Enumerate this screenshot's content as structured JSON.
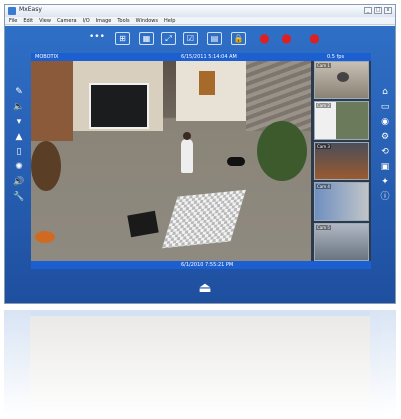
{
  "window": {
    "title": "MxEasy",
    "controls": [
      "_",
      "□",
      "x"
    ]
  },
  "menu": [
    "File",
    "Edit",
    "View",
    "Camera",
    "I/O",
    "Image",
    "Tools",
    "Windows",
    "Help"
  ],
  "toolbar": {
    "dots": "•••",
    "icons": [
      "layout-full-icon",
      "layout-grid-icon",
      "expand-icon",
      "check-icon",
      "export-icon",
      "lock-icon",
      "record-icon",
      "alarm-icon",
      "cloud-icon"
    ]
  },
  "video": {
    "top_left": "MOBOTIX",
    "top_center": "6/15/2011 5:14:04 AM",
    "top_right": "0.5 fps",
    "bottom_center": "6/1/2010 7:55:21 PM",
    "thumb_labels": [
      "Cam 1",
      "Cam 2",
      "Cam 3",
      "Cam 4",
      "Cam 5"
    ]
  },
  "left_tools": [
    "brush-icon",
    "speaker-icon",
    "signal-icon",
    "triangle-icon",
    "door-icon",
    "light-icon",
    "sound-icon",
    "wrench-icon"
  ],
  "right_tools": [
    "home-icon",
    "frame-icon",
    "target-icon",
    "gear-icon",
    "recycle-icon",
    "camera-icon",
    "star-icon",
    "info-icon"
  ],
  "glyphs": {
    "left": [
      "✎",
      "🔈",
      "▾",
      "▲",
      "▯",
      "✺",
      "🔊",
      "🔧"
    ],
    "right": [
      "⌂",
      "▭",
      "◉",
      "⚙",
      "⟲",
      "▣",
      "✦",
      "ⓘ"
    ],
    "toolbar": [
      "⊞",
      "▦",
      "⤢",
      "☑",
      "▤",
      "🔒",
      "●",
      "●",
      "●"
    ],
    "bottom": "⏏"
  },
  "colors": {
    "client_blue": "#2f6fc6",
    "status_bar": "#1c5fd0",
    "record_red": "#e02020"
  }
}
